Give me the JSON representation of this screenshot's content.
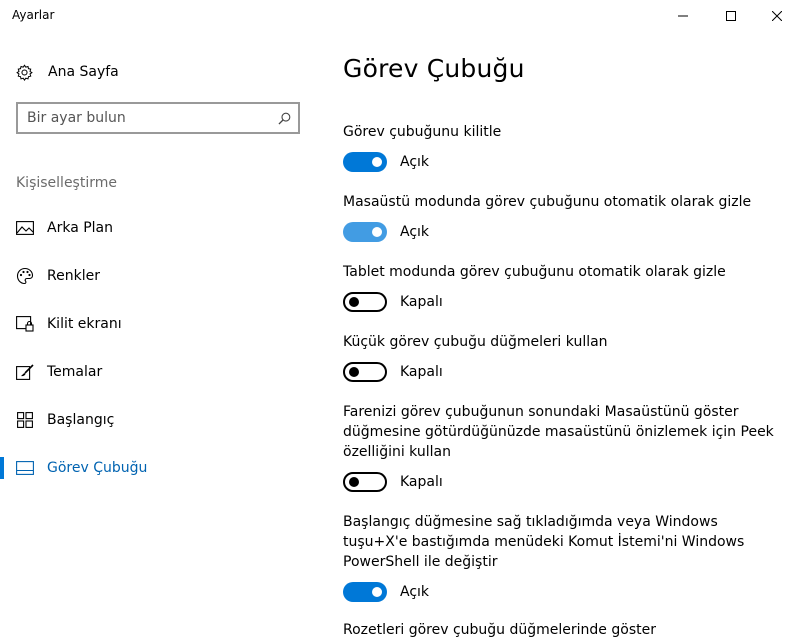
{
  "window": {
    "title": "Ayarlar"
  },
  "sidebar": {
    "home_label": "Ana Sayfa",
    "search_placeholder": "Bir ayar bulun",
    "section_title": "Kişiselleştirme",
    "items": [
      {
        "label": "Arka Plan",
        "icon": "picture-icon",
        "active": false
      },
      {
        "label": "Renkler",
        "icon": "palette-icon",
        "active": false
      },
      {
        "label": "Kilit ekranı",
        "icon": "lock-screen-icon",
        "active": false
      },
      {
        "label": "Temalar",
        "icon": "brush-icon",
        "active": false
      },
      {
        "label": "Başlangıç",
        "icon": "start-menu-icon",
        "active": false
      },
      {
        "label": "Görev Çubuğu",
        "icon": "taskbar-icon",
        "active": true
      }
    ]
  },
  "main": {
    "title": "Görev Çubuğu",
    "settings": [
      {
        "label": "Görev çubuğunu kilitle",
        "state": "on",
        "state_label": "Açık"
      },
      {
        "label": "Masaüstü modunda görev çubuğunu otomatik olarak gizle",
        "state": "on",
        "state_label": "Açık"
      },
      {
        "label": "Tablet modunda görev çubuğunu otomatik olarak gizle",
        "state": "off",
        "state_label": "Kapalı"
      },
      {
        "label": "Küçük görev çubuğu düğmeleri kullan",
        "state": "off",
        "state_label": "Kapalı"
      },
      {
        "label": "Farenizi görev çubuğunun sonundaki Masaüstünü göster düğmesine götürdüğünüzde masaüstünü önizlemek için Peek özelliğini kullan",
        "state": "off",
        "state_label": "Kapalı"
      },
      {
        "label": "Başlangıç düğmesine sağ tıkladığımda veya Windows tuşu+X'e bastığımda menüdeki Komut İstemi'ni Windows PowerShell ile değiştir",
        "state": "on",
        "state_label": "Açık"
      }
    ],
    "partial_label": "Rozetleri görev çubuğu düğmelerinde göster"
  },
  "colors": {
    "accent": "#0078d7",
    "accent_hover": "#429ce3",
    "active_nav_text": "#0063b1"
  }
}
